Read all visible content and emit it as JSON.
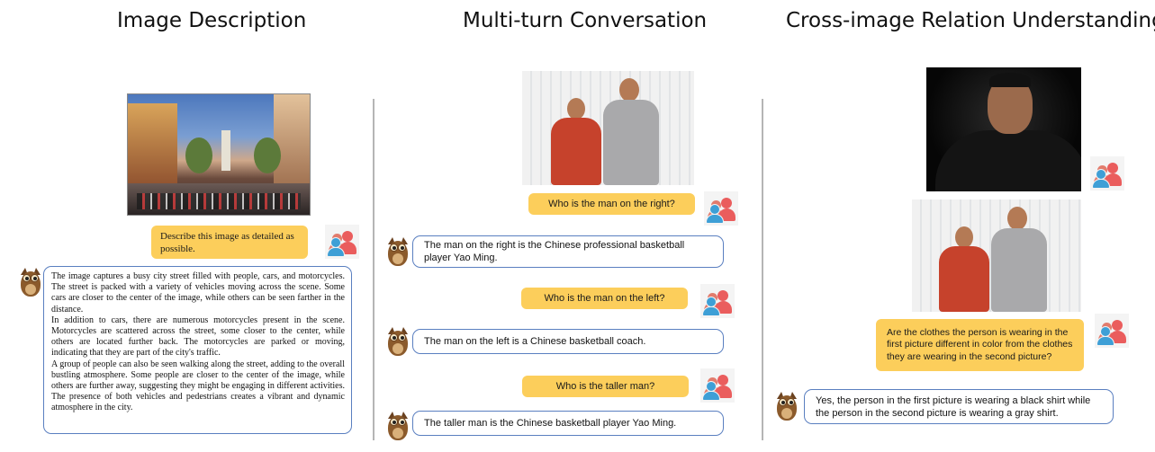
{
  "titles": {
    "image_description": "Image Description",
    "multi_turn": "Multi-turn Conversation",
    "cross_image": "Cross-image Relation Understanding"
  },
  "image_description": {
    "question": "Describe this image as detailed as possible.",
    "answer_p1": "The image captures a busy city street filled with people, cars, and motorcycles. The street is packed with a variety of vehicles moving across the scene. Some cars are closer to the center of the image, while others can be seen farther in the distance.",
    "answer_p2": "In addition to cars, there are numerous motorcycles present in the scene. Motorcycles are scattered across the street, some closer to the center, while others are located further back. The motorcycles are parked or moving, indicating that they are part of the city's traffic.",
    "answer_p3": "A group of people can also be seen walking along the street, adding to the overall bustling atmosphere. Some people are closer to the center of the image, while others are further away, suggesting they might be engaging in different activities. The presence of both vehicles and pedestrians creates a vibrant and dynamic atmosphere in the city."
  },
  "multi_turn": {
    "turns": [
      {
        "question": "Who is the man on the right?",
        "answer": "The man on the right is the Chinese professional basketball player Yao Ming."
      },
      {
        "question": "Who is the man on the left?",
        "answer": "The man on the left is a Chinese basketball coach."
      },
      {
        "question": "Who is the taller man?",
        "answer": "The taller man is the Chinese basketball player Yao Ming."
      }
    ]
  },
  "cross_image": {
    "question": "Are the clothes the person is wearing in the first picture different in color from the clothes they are wearing in the second picture?",
    "answer": "Yes, the person in the first picture is wearing a black shirt while the person in the second picture is wearing a gray shirt."
  },
  "icons": {
    "user": "user-group-icon",
    "assistant": "owl-icon"
  },
  "colors": {
    "question_bubble": "#fcce5b",
    "answer_border": "#5a7fc0"
  }
}
